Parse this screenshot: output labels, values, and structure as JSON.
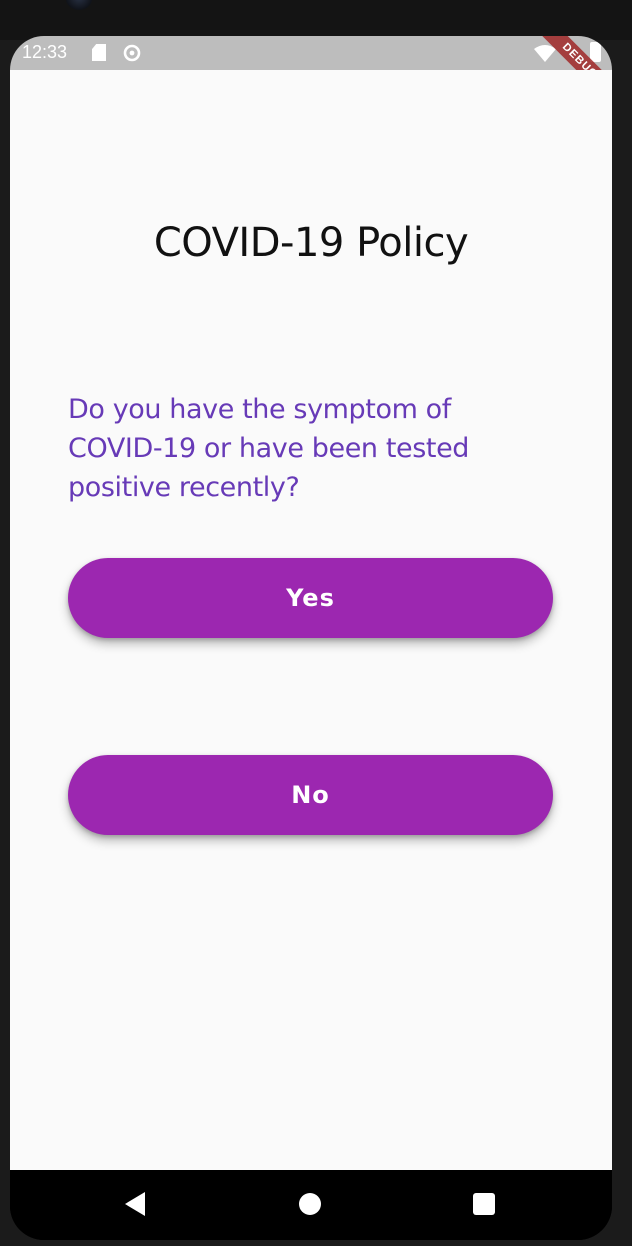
{
  "status_bar": {
    "time": "12:33",
    "icons": [
      "sd-card-icon",
      "sync-icon",
      "wifi-icon",
      "battery-icon"
    ]
  },
  "debug_banner": "DEBUG",
  "page": {
    "title": "COVID-19 Policy",
    "question": "Do you have the symptom of COVID-19 or have been tested positive recently?",
    "yes_label": "Yes",
    "no_label": "No"
  },
  "nav_bar": {
    "icons": [
      "back-icon",
      "home-icon",
      "recents-icon"
    ]
  },
  "colors": {
    "question_text": "#673ab7",
    "button_bg": "#9c27b0",
    "status_bar_bg": "#bdbdbd",
    "debug_ribbon": "#a02828"
  }
}
